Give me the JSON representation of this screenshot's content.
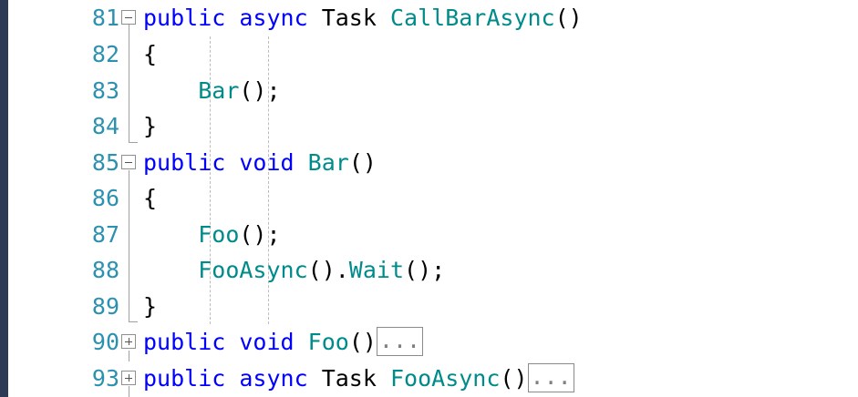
{
  "lines": [
    {
      "n": "81",
      "fold": "minus",
      "tokens": [
        [
          "kw",
          "public"
        ],
        [
          "t",
          " "
        ],
        [
          "kw",
          "async"
        ],
        [
          "t",
          " "
        ],
        [
          "t",
          "Task"
        ],
        [
          "t",
          " "
        ],
        [
          "mt",
          "CallBarAsync"
        ],
        [
          "t",
          "()"
        ]
      ]
    },
    {
      "n": "82",
      "tokens": [
        [
          "t",
          "{"
        ]
      ]
    },
    {
      "n": "83",
      "tokens": [
        [
          "t",
          "    "
        ],
        [
          "mt",
          "Bar"
        ],
        [
          "t",
          "();"
        ]
      ]
    },
    {
      "n": "84",
      "tokens": [
        [
          "t",
          "}"
        ]
      ]
    },
    {
      "n": "85",
      "fold": "minus",
      "tokens": [
        [
          "kw",
          "public"
        ],
        [
          "t",
          " "
        ],
        [
          "kw",
          "void"
        ],
        [
          "t",
          " "
        ],
        [
          "mt",
          "Bar"
        ],
        [
          "t",
          "()"
        ]
      ]
    },
    {
      "n": "86",
      "tokens": [
        [
          "t",
          "{"
        ]
      ]
    },
    {
      "n": "87",
      "tokens": [
        [
          "t",
          "    "
        ],
        [
          "mt",
          "Foo"
        ],
        [
          "t",
          "();"
        ]
      ]
    },
    {
      "n": "88",
      "tokens": [
        [
          "t",
          "    "
        ],
        [
          "mt",
          "FooAsync"
        ],
        [
          "t",
          "()."
        ],
        [
          "mt",
          "Wait"
        ],
        [
          "t",
          "();"
        ]
      ]
    },
    {
      "n": "89",
      "tokens": [
        [
          "t",
          "}"
        ]
      ]
    },
    {
      "n": "90",
      "fold": "plus",
      "tokens": [
        [
          "kw",
          "public"
        ],
        [
          "t",
          " "
        ],
        [
          "kw",
          "void"
        ],
        [
          "t",
          " "
        ],
        [
          "mt",
          "Foo"
        ],
        [
          "t",
          "()"
        ],
        [
          "collapsed",
          "..."
        ]
      ]
    },
    {
      "n": "93",
      "fold": "plus",
      "tokens": [
        [
          "kw",
          "public"
        ],
        [
          "t",
          " "
        ],
        [
          "kw",
          "async"
        ],
        [
          "t",
          " "
        ],
        [
          "t",
          "Task"
        ],
        [
          "t",
          " "
        ],
        [
          "mt",
          "FooAsync"
        ],
        [
          "t",
          "()"
        ],
        [
          "collapsed",
          "..."
        ]
      ]
    }
  ],
  "colors": {
    "keyword": "#0000ff",
    "method": "#008b8b",
    "line_number": "#2b91af",
    "text": "#000000",
    "margin_strip": "#2d3a55"
  }
}
